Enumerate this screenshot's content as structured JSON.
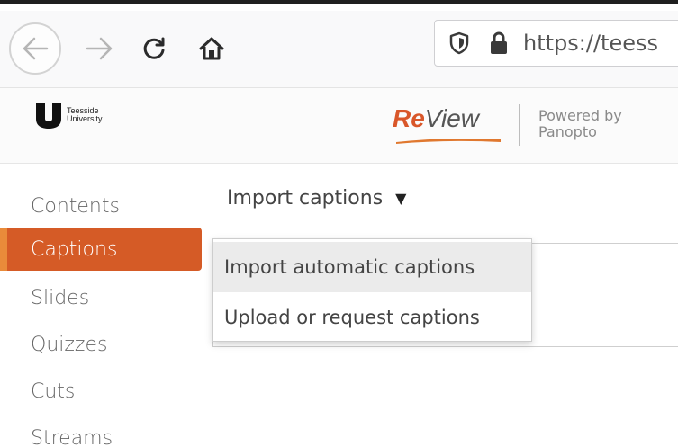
{
  "browser": {
    "url": "https://teess"
  },
  "header": {
    "university_logo_line1": "Teesside",
    "university_logo_line2": "University",
    "review_brand_prefix": "Re",
    "review_brand_suffix": "View",
    "powered_line1": "Powered by",
    "powered_line2": "Panopto"
  },
  "sidebar": {
    "items": [
      {
        "label": "Contents",
        "active": false
      },
      {
        "label": "Captions",
        "active": true
      },
      {
        "label": "Slides",
        "active": false
      },
      {
        "label": "Quizzes",
        "active": false
      },
      {
        "label": "Cuts",
        "active": false
      },
      {
        "label": "Streams",
        "active": false
      }
    ]
  },
  "main": {
    "import_label": "Import captions",
    "dropdown": {
      "items": [
        {
          "label": "Import automatic captions",
          "hovered": true
        },
        {
          "label": "Upload or request captions",
          "hovered": false
        }
      ]
    }
  },
  "colors": {
    "accent": "#d55b26",
    "accent_edge": "#e98b3a"
  }
}
